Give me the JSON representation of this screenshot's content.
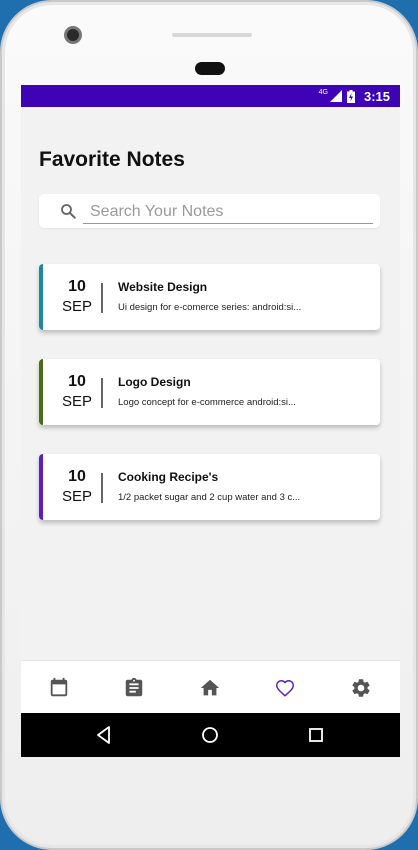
{
  "status_bar": {
    "network": "4G",
    "time": "3:15"
  },
  "page": {
    "title": "Favorite Notes"
  },
  "search": {
    "placeholder": "Search Your Notes",
    "value": ""
  },
  "notes": [
    {
      "day": "10",
      "month": "SEP",
      "title": "Website Design",
      "description": "Ui design for e-comerce series: android:si...",
      "accent_color": "#1a8aa1"
    },
    {
      "day": "10",
      "month": "SEP",
      "title": "Logo Design",
      "description": "Logo concept for e-commerce  android:si...",
      "accent_color": "#4e6b1c"
    },
    {
      "day": "10",
      "month": "SEP",
      "title": "Cooking Recipe's",
      "description": "1/2 packet sugar and 2 cup water and 3 c...",
      "accent_color": "#5b1ec4"
    }
  ],
  "bottom_nav": {
    "items": [
      {
        "icon": "calendar-icon",
        "active": false
      },
      {
        "icon": "clipboard-icon",
        "active": false
      },
      {
        "icon": "home-icon",
        "active": false
      },
      {
        "icon": "heart-icon",
        "active": true
      },
      {
        "icon": "gear-icon",
        "active": false
      }
    ],
    "active_color": "#5b1ec4",
    "inactive_color": "#555555"
  },
  "colors": {
    "status_bar": "#3d03b5",
    "background": "#f2f2f2"
  }
}
